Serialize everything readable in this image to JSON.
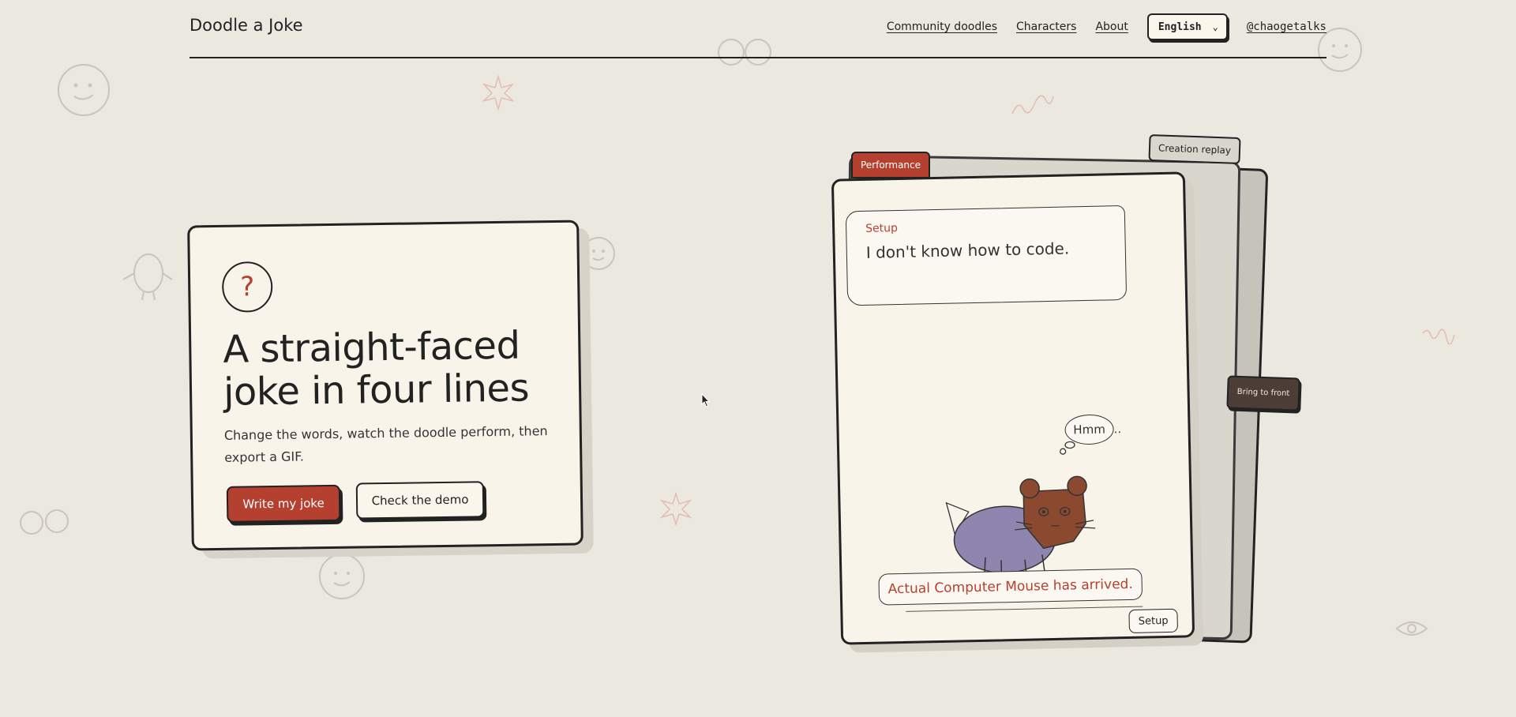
{
  "header": {
    "brand": "Doodle a Joke",
    "nav": {
      "community": "Community doodles",
      "characters": "Characters",
      "about": "About"
    },
    "language": {
      "selected": "English",
      "chevron_icon": "chevron-down-icon"
    },
    "handle": "@chaogetalks"
  },
  "hero": {
    "icon": "?",
    "title": "A straight-faced joke in four lines",
    "description": "Change the words, watch the doodle perform, then export a GIF.",
    "primary_cta": "Write my joke",
    "secondary_cta": "Check the demo"
  },
  "stage": {
    "tabs": {
      "performance": "Performance",
      "replay": "Creation replay"
    },
    "bring_to_front": "Bring to front",
    "speech": {
      "label": "Setup",
      "text": "I don't know how to code."
    },
    "thought": "Hmm",
    "thought_trail": "..",
    "caption": "Actual Computer Mouse has arrived.",
    "badge": "Setup"
  },
  "colors": {
    "background": "#ebe8e0",
    "card": "#f8f4ea",
    "accent": "#b5402f",
    "ink": "#222222"
  }
}
